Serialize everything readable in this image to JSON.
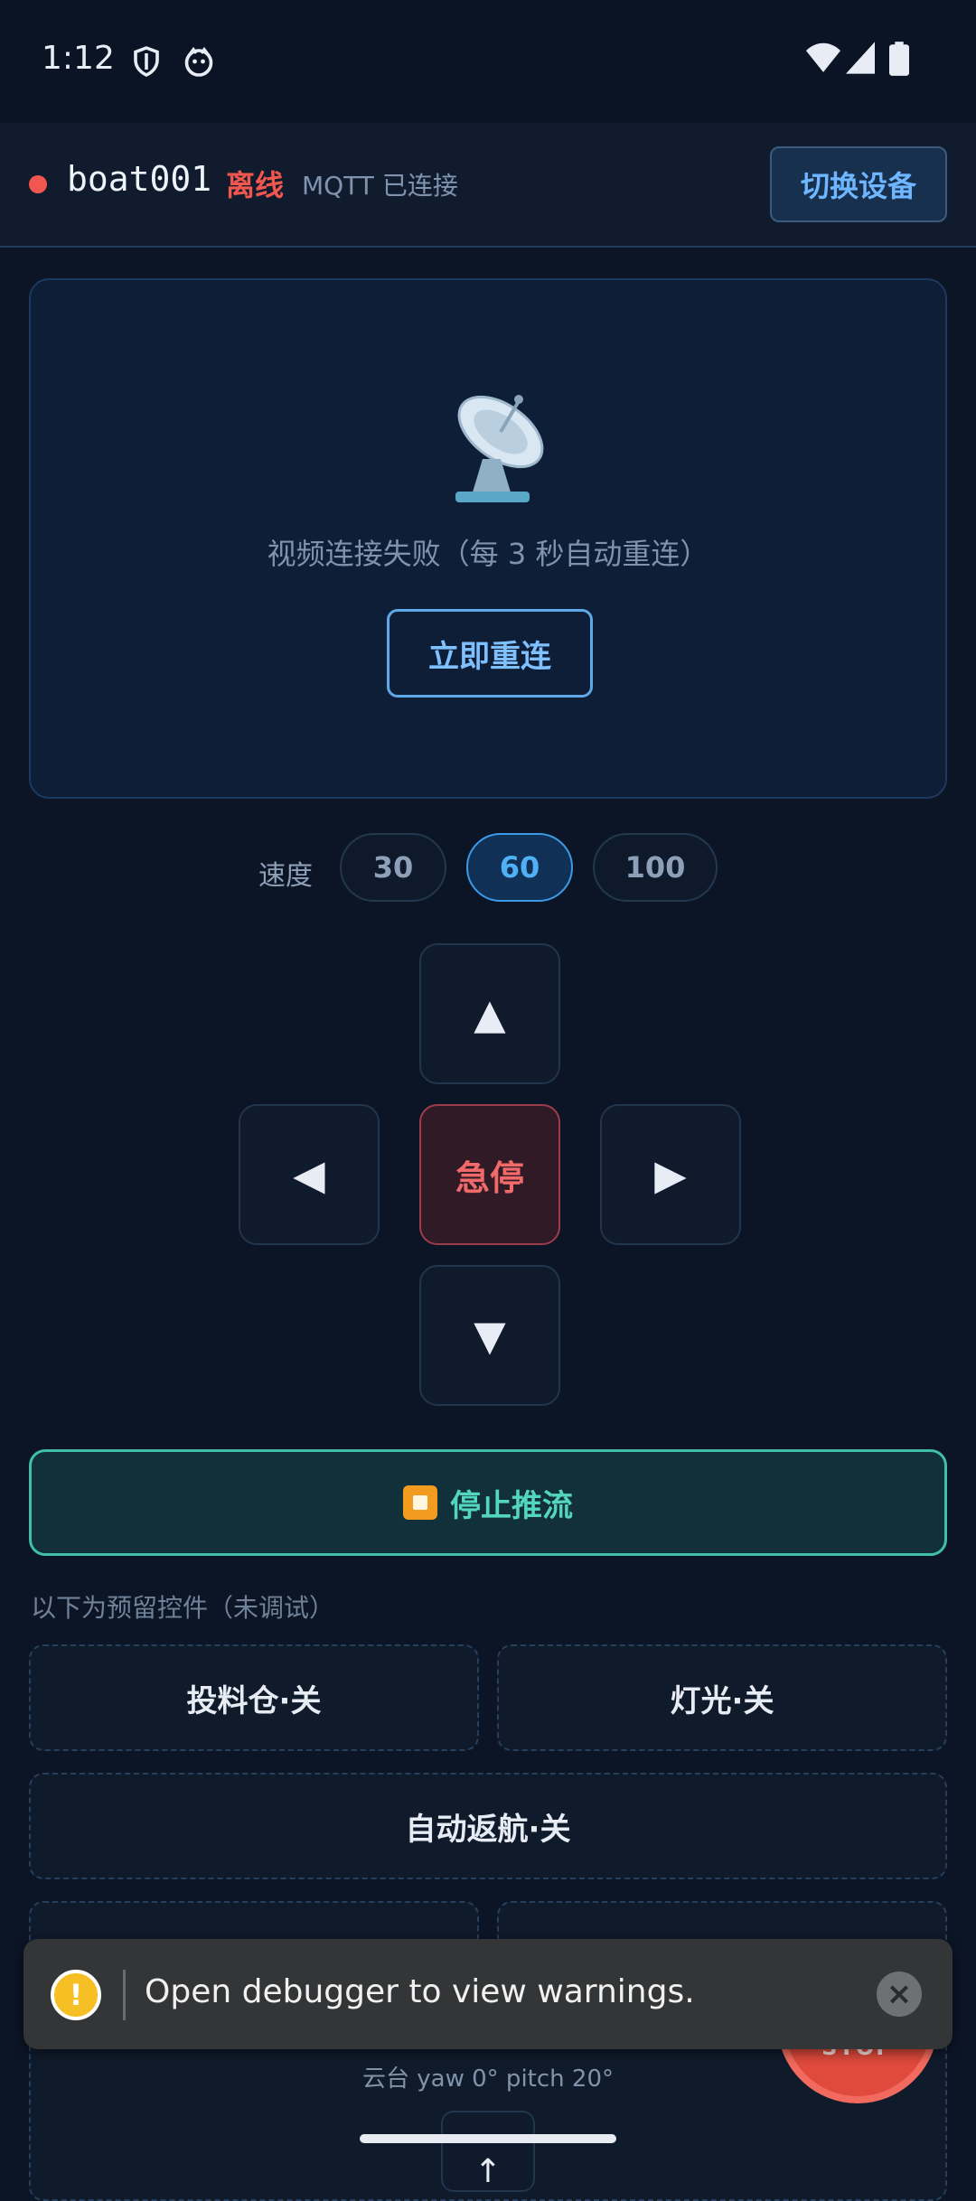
{
  "status_bar": {
    "time": "1:12"
  },
  "header": {
    "device": "boat001",
    "state": "离线",
    "mqtt": "MQTT 已连接",
    "switch_label": "切换设备",
    "status_color": "#f2574f"
  },
  "video": {
    "icon": "satellite-dish-icon",
    "message": "视频连接失败（每 3 秒自动重连）",
    "reconnect_label": "立即重连"
  },
  "speed": {
    "label": "速度",
    "options": [
      "30",
      "60",
      "100"
    ],
    "selected": "60"
  },
  "dpad": {
    "up": "▲",
    "left": "◀",
    "stop": "急停",
    "right": "▶",
    "down": "▼"
  },
  "stream": {
    "label": "停止推流"
  },
  "reserved": {
    "label": "以下为预留控件（未调试）",
    "hopper": "投料仓·关",
    "light": "灯光·关",
    "return_home": "自动返航·关"
  },
  "gimbal": {
    "text": "云台  yaw 0°  pitch 20°",
    "up": "↑"
  },
  "stop_fab": {
    "label": "STOP"
  },
  "toast": {
    "message": "Open debugger to view warnings."
  }
}
